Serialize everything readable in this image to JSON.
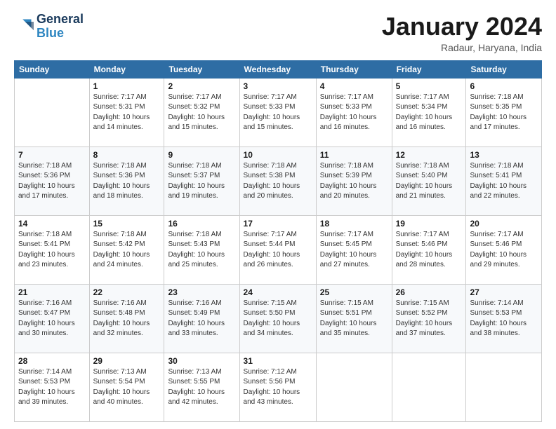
{
  "logo": {
    "line1": "General",
    "line2": "Blue"
  },
  "title": "January 2024",
  "subtitle": "Radaur, Haryana, India",
  "days_header": [
    "Sunday",
    "Monday",
    "Tuesday",
    "Wednesday",
    "Thursday",
    "Friday",
    "Saturday"
  ],
  "weeks": [
    [
      {
        "day": "",
        "sunrise": "",
        "sunset": "",
        "daylight": ""
      },
      {
        "day": "1",
        "sunrise": "Sunrise: 7:17 AM",
        "sunset": "Sunset: 5:31 PM",
        "daylight": "Daylight: 10 hours and 14 minutes."
      },
      {
        "day": "2",
        "sunrise": "Sunrise: 7:17 AM",
        "sunset": "Sunset: 5:32 PM",
        "daylight": "Daylight: 10 hours and 15 minutes."
      },
      {
        "day": "3",
        "sunrise": "Sunrise: 7:17 AM",
        "sunset": "Sunset: 5:33 PM",
        "daylight": "Daylight: 10 hours and 15 minutes."
      },
      {
        "day": "4",
        "sunrise": "Sunrise: 7:17 AM",
        "sunset": "Sunset: 5:33 PM",
        "daylight": "Daylight: 10 hours and 16 minutes."
      },
      {
        "day": "5",
        "sunrise": "Sunrise: 7:17 AM",
        "sunset": "Sunset: 5:34 PM",
        "daylight": "Daylight: 10 hours and 16 minutes."
      },
      {
        "day": "6",
        "sunrise": "Sunrise: 7:18 AM",
        "sunset": "Sunset: 5:35 PM",
        "daylight": "Daylight: 10 hours and 17 minutes."
      }
    ],
    [
      {
        "day": "7",
        "sunrise": "Sunrise: 7:18 AM",
        "sunset": "Sunset: 5:36 PM",
        "daylight": "Daylight: 10 hours and 17 minutes."
      },
      {
        "day": "8",
        "sunrise": "Sunrise: 7:18 AM",
        "sunset": "Sunset: 5:36 PM",
        "daylight": "Daylight: 10 hours and 18 minutes."
      },
      {
        "day": "9",
        "sunrise": "Sunrise: 7:18 AM",
        "sunset": "Sunset: 5:37 PM",
        "daylight": "Daylight: 10 hours and 19 minutes."
      },
      {
        "day": "10",
        "sunrise": "Sunrise: 7:18 AM",
        "sunset": "Sunset: 5:38 PM",
        "daylight": "Daylight: 10 hours and 20 minutes."
      },
      {
        "day": "11",
        "sunrise": "Sunrise: 7:18 AM",
        "sunset": "Sunset: 5:39 PM",
        "daylight": "Daylight: 10 hours and 20 minutes."
      },
      {
        "day": "12",
        "sunrise": "Sunrise: 7:18 AM",
        "sunset": "Sunset: 5:40 PM",
        "daylight": "Daylight: 10 hours and 21 minutes."
      },
      {
        "day": "13",
        "sunrise": "Sunrise: 7:18 AM",
        "sunset": "Sunset: 5:41 PM",
        "daylight": "Daylight: 10 hours and 22 minutes."
      }
    ],
    [
      {
        "day": "14",
        "sunrise": "Sunrise: 7:18 AM",
        "sunset": "Sunset: 5:41 PM",
        "daylight": "Daylight: 10 hours and 23 minutes."
      },
      {
        "day": "15",
        "sunrise": "Sunrise: 7:18 AM",
        "sunset": "Sunset: 5:42 PM",
        "daylight": "Daylight: 10 hours and 24 minutes."
      },
      {
        "day": "16",
        "sunrise": "Sunrise: 7:18 AM",
        "sunset": "Sunset: 5:43 PM",
        "daylight": "Daylight: 10 hours and 25 minutes."
      },
      {
        "day": "17",
        "sunrise": "Sunrise: 7:17 AM",
        "sunset": "Sunset: 5:44 PM",
        "daylight": "Daylight: 10 hours and 26 minutes."
      },
      {
        "day": "18",
        "sunrise": "Sunrise: 7:17 AM",
        "sunset": "Sunset: 5:45 PM",
        "daylight": "Daylight: 10 hours and 27 minutes."
      },
      {
        "day": "19",
        "sunrise": "Sunrise: 7:17 AM",
        "sunset": "Sunset: 5:46 PM",
        "daylight": "Daylight: 10 hours and 28 minutes."
      },
      {
        "day": "20",
        "sunrise": "Sunrise: 7:17 AM",
        "sunset": "Sunset: 5:46 PM",
        "daylight": "Daylight: 10 hours and 29 minutes."
      }
    ],
    [
      {
        "day": "21",
        "sunrise": "Sunrise: 7:16 AM",
        "sunset": "Sunset: 5:47 PM",
        "daylight": "Daylight: 10 hours and 30 minutes."
      },
      {
        "day": "22",
        "sunrise": "Sunrise: 7:16 AM",
        "sunset": "Sunset: 5:48 PM",
        "daylight": "Daylight: 10 hours and 32 minutes."
      },
      {
        "day": "23",
        "sunrise": "Sunrise: 7:16 AM",
        "sunset": "Sunset: 5:49 PM",
        "daylight": "Daylight: 10 hours and 33 minutes."
      },
      {
        "day": "24",
        "sunrise": "Sunrise: 7:15 AM",
        "sunset": "Sunset: 5:50 PM",
        "daylight": "Daylight: 10 hours and 34 minutes."
      },
      {
        "day": "25",
        "sunrise": "Sunrise: 7:15 AM",
        "sunset": "Sunset: 5:51 PM",
        "daylight": "Daylight: 10 hours and 35 minutes."
      },
      {
        "day": "26",
        "sunrise": "Sunrise: 7:15 AM",
        "sunset": "Sunset: 5:52 PM",
        "daylight": "Daylight: 10 hours and 37 minutes."
      },
      {
        "day": "27",
        "sunrise": "Sunrise: 7:14 AM",
        "sunset": "Sunset: 5:53 PM",
        "daylight": "Daylight: 10 hours and 38 minutes."
      }
    ],
    [
      {
        "day": "28",
        "sunrise": "Sunrise: 7:14 AM",
        "sunset": "Sunset: 5:53 PM",
        "daylight": "Daylight: 10 hours and 39 minutes."
      },
      {
        "day": "29",
        "sunrise": "Sunrise: 7:13 AM",
        "sunset": "Sunset: 5:54 PM",
        "daylight": "Daylight: 10 hours and 40 minutes."
      },
      {
        "day": "30",
        "sunrise": "Sunrise: 7:13 AM",
        "sunset": "Sunset: 5:55 PM",
        "daylight": "Daylight: 10 hours and 42 minutes."
      },
      {
        "day": "31",
        "sunrise": "Sunrise: 7:12 AM",
        "sunset": "Sunset: 5:56 PM",
        "daylight": "Daylight: 10 hours and 43 minutes."
      },
      {
        "day": "",
        "sunrise": "",
        "sunset": "",
        "daylight": ""
      },
      {
        "day": "",
        "sunrise": "",
        "sunset": "",
        "daylight": ""
      },
      {
        "day": "",
        "sunrise": "",
        "sunset": "",
        "daylight": ""
      }
    ]
  ]
}
